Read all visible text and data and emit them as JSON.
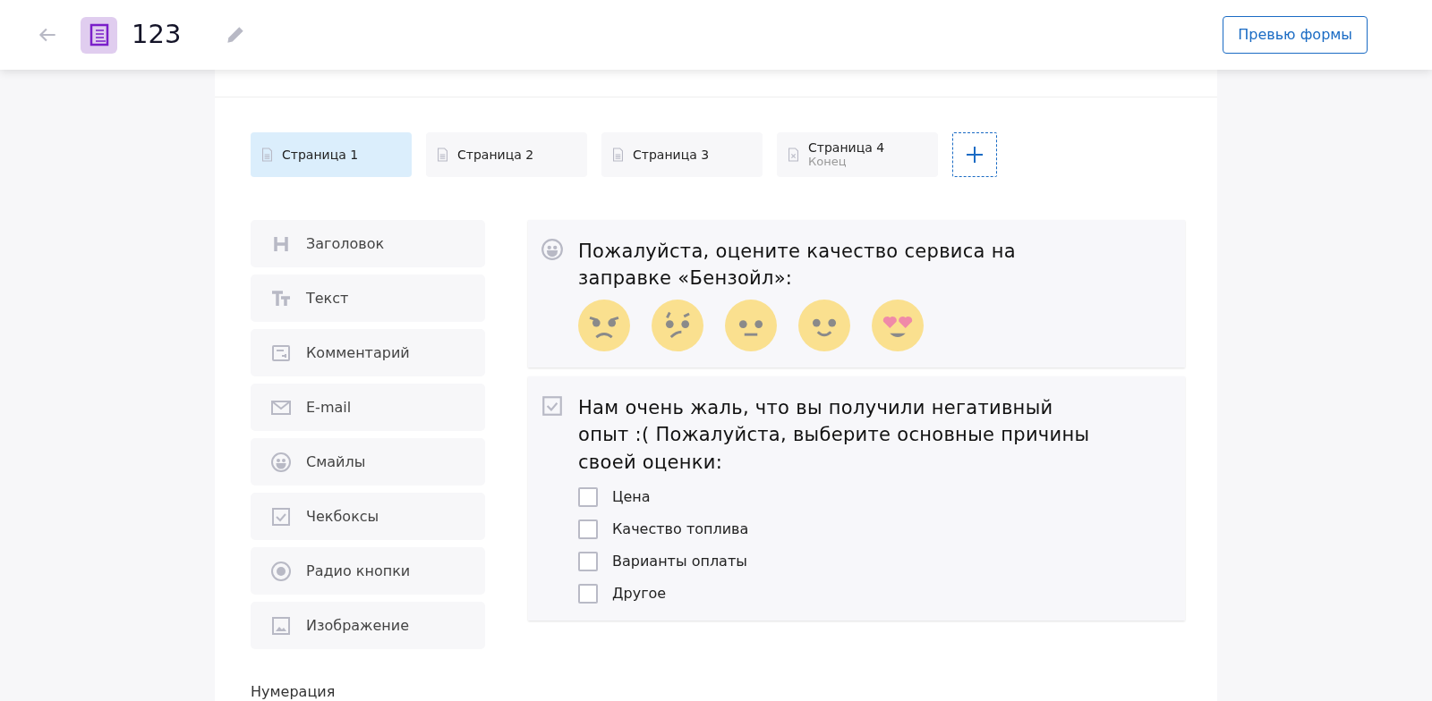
{
  "header": {
    "title": "123",
    "preview_button": "Превью формы"
  },
  "pages": [
    {
      "label": "Страница 1",
      "kind": "page",
      "selected": true
    },
    {
      "label": "Страница 2",
      "kind": "page",
      "selected": false
    },
    {
      "label": "Страница 3",
      "kind": "page",
      "selected": false
    },
    {
      "label": "Страница 4",
      "sublabel": "Конец",
      "kind": "end",
      "selected": false
    }
  ],
  "elements": [
    {
      "label": "Заголовок",
      "kind": "heading"
    },
    {
      "label": "Текст",
      "kind": "text"
    },
    {
      "label": "Комментарий",
      "kind": "comment"
    },
    {
      "label": "E-mail",
      "kind": "email"
    },
    {
      "label": "Смайлы",
      "kind": "smileys"
    },
    {
      "label": "Чекбоксы",
      "kind": "checkboxes"
    },
    {
      "label": "Радио кнопки",
      "kind": "radio"
    },
    {
      "label": "Изображение",
      "kind": "image"
    }
  ],
  "numbering_label": "Нумерация",
  "questions": [
    {
      "kind": "smileys",
      "text": "Пожалуйста, оцените качество сервиса на заправке «Бензойл»:"
    },
    {
      "kind": "checkboxes",
      "text": "Нам очень жаль, что вы получили негативный опыт :( Пожалуйста, выберите основные причины своей оценки:",
      "options": [
        {
          "label": "Цена",
          "checked": false
        },
        {
          "label": "Качество топлива",
          "checked": false
        },
        {
          "label": "Варианты оплаты",
          "checked": false
        },
        {
          "label": "Другое",
          "checked": false
        }
      ]
    }
  ]
}
